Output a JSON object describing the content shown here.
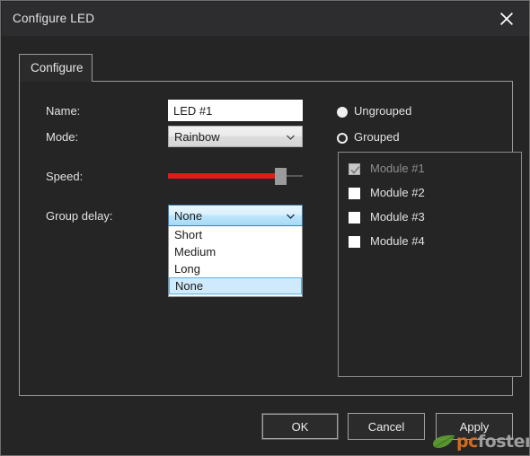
{
  "window": {
    "title": "Configure LED",
    "close_icon": "close-x-icon"
  },
  "tabs": [
    {
      "label": "Configure",
      "active": true
    }
  ],
  "form": {
    "name": {
      "label": "Name:",
      "value": "LED #1",
      "placeholder": ""
    },
    "mode": {
      "label": "Mode:",
      "value": "Rainbow",
      "chevron_icon": "chevron-down-icon"
    },
    "speed": {
      "label": "Speed:",
      "percent": 80,
      "fill_color": "#e01b1b",
      "thumb_color": "#9b9b9b"
    },
    "group_delay": {
      "label": "Group delay:",
      "value": "None",
      "chevron_icon": "chevron-down-icon",
      "expanded": true,
      "options": [
        {
          "label": "Short",
          "selected": false
        },
        {
          "label": "Medium",
          "selected": false
        },
        {
          "label": "Long",
          "selected": false
        },
        {
          "label": "None",
          "selected": true
        }
      ]
    }
  },
  "grouping": {
    "options": [
      {
        "label": "Ungrouped",
        "state": "filled"
      },
      {
        "label": "Grouped",
        "state": "ring"
      }
    ],
    "modules": [
      {
        "label": "Module #1",
        "checked": true,
        "disabled": true
      },
      {
        "label": "Module #2",
        "checked": false,
        "disabled": false
      },
      {
        "label": "Module #3",
        "checked": false,
        "disabled": false
      },
      {
        "label": "Module #4",
        "checked": false,
        "disabled": false
      }
    ]
  },
  "footer": {
    "ok": "OK",
    "cancel": "Cancel",
    "apply": "Apply"
  },
  "watermark": {
    "part1": "pc",
    "part2": "foster",
    "leaf_icon": "leaf-icon",
    "leaf_color": "#5f9e31",
    "pc_color": "#e2711d",
    "foster_color": "#a8a8a8"
  }
}
